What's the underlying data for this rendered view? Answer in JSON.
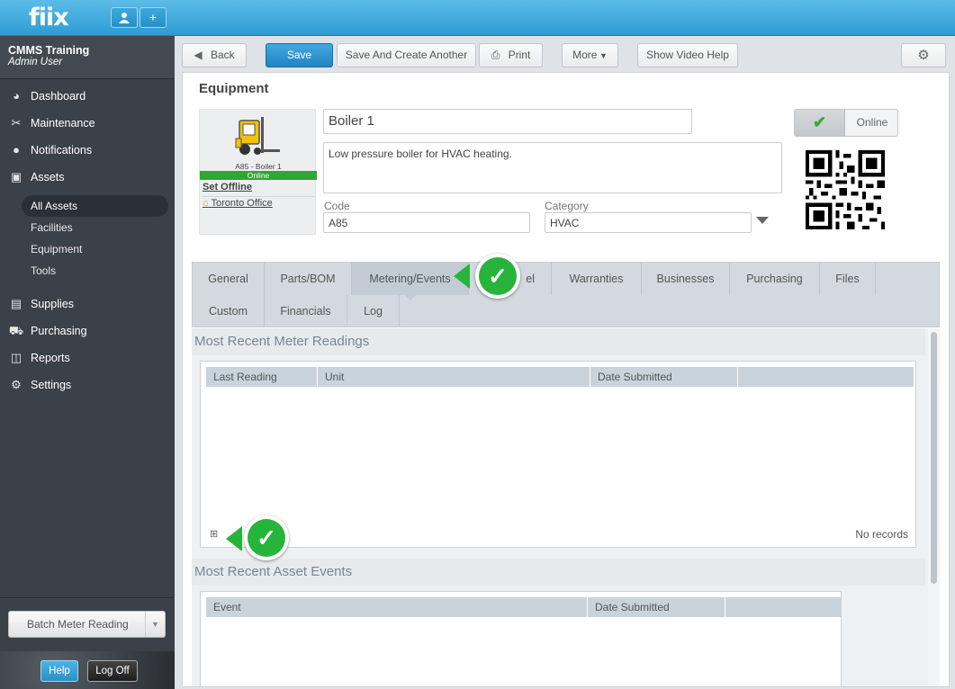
{
  "brand": {
    "logo": "fiix"
  },
  "account": {
    "name": "CMMS Training",
    "user": "Admin User"
  },
  "sidebar": {
    "items": [
      {
        "label": "Dashboard"
      },
      {
        "label": "Maintenance"
      },
      {
        "label": "Notifications"
      },
      {
        "label": "Assets"
      }
    ],
    "asset_sub": [
      {
        "label": "All Assets"
      },
      {
        "label": "Facilities"
      },
      {
        "label": "Equipment"
      },
      {
        "label": "Tools"
      }
    ],
    "items2": [
      {
        "label": "Supplies"
      },
      {
        "label": "Purchasing"
      },
      {
        "label": "Reports"
      },
      {
        "label": "Settings"
      }
    ],
    "batch_label": "Batch Meter Reading",
    "help_label": "Help",
    "logoff_label": "Log Off"
  },
  "toolbar": {
    "back": "Back",
    "save": "Save",
    "save_another": "Save And Create Another",
    "print": "Print",
    "more": "More",
    "video_help": "Show Video Help"
  },
  "page": {
    "title": "Equipment"
  },
  "asset": {
    "caption": "A85 - Boiler 1",
    "status_bar": "Online",
    "set_offline": "Set Offline",
    "location": "Toronto Office",
    "name": "Boiler 1",
    "description": "Low pressure boiler for HVAC heating.",
    "code_label": "Code",
    "code": "A85",
    "category_label": "Category",
    "category": "HVAC",
    "toggle_label": "Online"
  },
  "tabs": {
    "row1": [
      "General",
      "Parts/BOM",
      "Metering/Events",
      "el",
      "Warranties",
      "Businesses",
      "Purchasing",
      "Files"
    ],
    "row2": [
      "Custom",
      "Financials",
      "Log"
    ]
  },
  "meter": {
    "title": "Most Recent Meter Readings",
    "columns": [
      "Last Reading",
      "Unit",
      "Date Submitted"
    ],
    "empty": "No records"
  },
  "events": {
    "title": "Most Recent Asset Events",
    "columns": [
      "Event",
      "Date Submitted"
    ]
  },
  "colors": {
    "accent": "#2f9bd3",
    "sidebar": "#3b4148",
    "callout": "#27b43b"
  }
}
